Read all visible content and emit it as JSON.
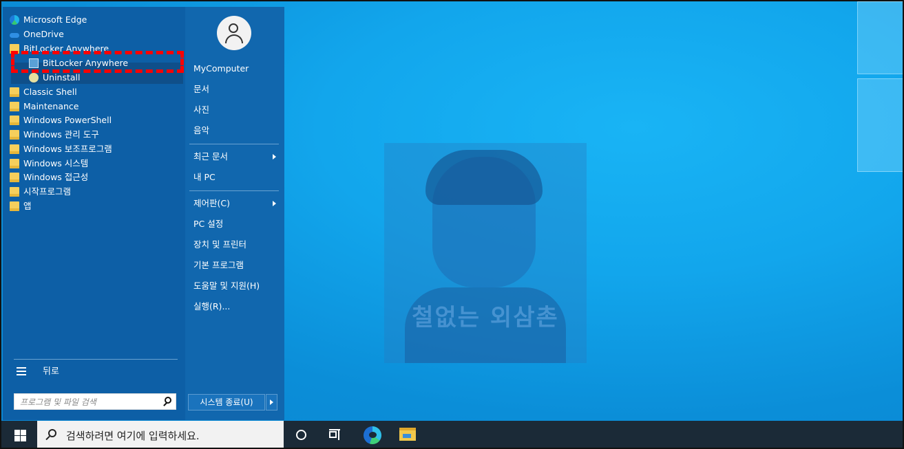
{
  "start_menu": {
    "programs": [
      {
        "label": "Microsoft Edge",
        "icon": "edge-icon"
      },
      {
        "label": "OneDrive",
        "icon": "onedrive-icon"
      },
      {
        "label": "BitLocker Anywhere",
        "icon": "folder-icon"
      },
      {
        "label": "BitLocker Anywhere",
        "icon": "bitlocker-icon",
        "sub": true
      },
      {
        "label": "Uninstall",
        "icon": "uninstall-icon",
        "sub": true
      },
      {
        "label": "Classic Shell",
        "icon": "folder-icon"
      },
      {
        "label": "Maintenance",
        "icon": "folder-icon"
      },
      {
        "label": "Windows PowerShell",
        "icon": "folder-icon"
      },
      {
        "label": "Windows 관리 도구",
        "icon": "folder-icon"
      },
      {
        "label": "Windows 보조프로그램",
        "icon": "folder-icon"
      },
      {
        "label": "Windows 시스템",
        "icon": "folder-icon"
      },
      {
        "label": "Windows 접근성",
        "icon": "folder-icon"
      },
      {
        "label": "시작프로그램",
        "icon": "folder-icon"
      },
      {
        "label": "앱",
        "icon": "folder-icon"
      }
    ],
    "back_label": "뒤로",
    "search_placeholder": "프로그램 및 파일 검색",
    "right_items": [
      {
        "label": "MyComputer"
      },
      {
        "label": "문서"
      },
      {
        "label": "사진"
      },
      {
        "label": "음악"
      },
      {
        "label": "최근 문서",
        "submenu": true
      },
      {
        "label": "내 PC"
      },
      {
        "label": "제어판(C)",
        "submenu": true
      },
      {
        "label": "PC 설정"
      },
      {
        "label": "장치 및 프린터"
      },
      {
        "label": "기본 프로그램"
      },
      {
        "label": "도움말 및 지원(H)"
      },
      {
        "label": "실행(R)..."
      }
    ],
    "shutdown_label": "시스템 종료(U)"
  },
  "taskbar": {
    "search_text": "검색하려면 여기에 입력하세요.",
    "apps": [
      "cortana-icon",
      "task-view-icon",
      "edge-icon",
      "file-explorer-icon"
    ]
  },
  "desktop": {
    "watermark_text": "철없는 외삼촌"
  },
  "colors": {
    "menu_left": "#0d5fa6",
    "menu_right": "#1167ae",
    "highlight_dash": "#ff0000",
    "taskbar": "#1b2a37"
  }
}
